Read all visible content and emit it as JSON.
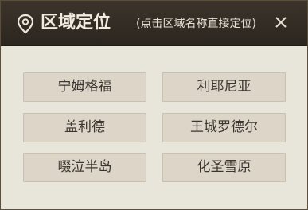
{
  "dialog": {
    "title": "区域定位",
    "hint": "(点击区域名称直接定位)",
    "icons": {
      "title_icon": "location-pin-icon",
      "close_icon": "close-icon"
    }
  },
  "regions": [
    {
      "label": "宁姆格福"
    },
    {
      "label": "利耶尼亚"
    },
    {
      "label": "盖利德"
    },
    {
      "label": "王城罗德尔"
    },
    {
      "label": "啜泣半岛"
    },
    {
      "label": "化圣雪原"
    }
  ],
  "colors": {
    "header_bg": "#2c2620",
    "body_bg": "#e8e5db",
    "button_bg": "#ddd6c8",
    "button_text": "#3a3530",
    "title_text": "#f2ece0"
  }
}
